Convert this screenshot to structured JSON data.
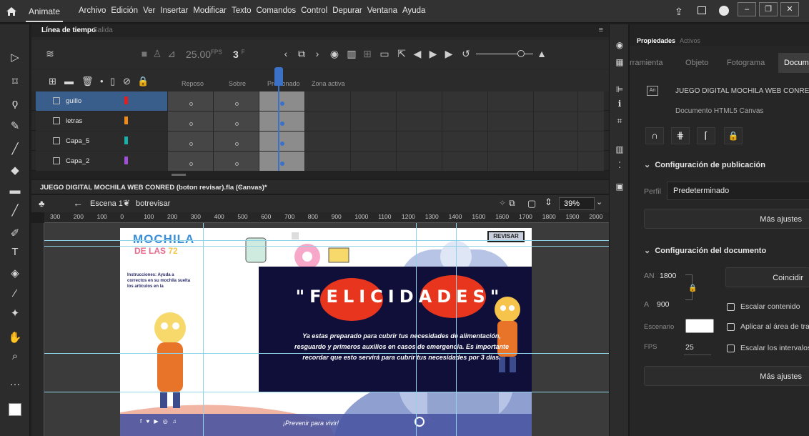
{
  "app": {
    "name": "Animate",
    "menus": [
      "Archivo",
      "Edición",
      "Ver",
      "Insertar",
      "Modificar",
      "Texto",
      "Comandos",
      "Control",
      "Depurar",
      "Ventana",
      "Ayuda"
    ]
  },
  "timeline": {
    "tabs": [
      "Línea de tiempo",
      "Salida"
    ],
    "fps": "25.00",
    "fps_unit": "FPS",
    "current_frame": "3",
    "frame_suffix": "F",
    "frame_labels": [
      "Reposo",
      "Sobre",
      "Presionado",
      "Zona activa"
    ],
    "layers": [
      {
        "name": "guillo",
        "color": "#e02020",
        "selected": true
      },
      {
        "name": "letras",
        "color": "#f08a1a",
        "selected": false
      },
      {
        "name": "Capa_5",
        "color": "#18b0a8",
        "selected": false
      },
      {
        "name": "Capa_2",
        "color": "#a050d8",
        "selected": false
      }
    ]
  },
  "document": {
    "tab": "JUEGO DIGITAL MOCHILA WEB CONRED (boton revisar).fla (Canvas)*",
    "scene": "Escena 1",
    "symbol": "botrevisar",
    "zoom": "39%",
    "ruler_marks": [
      "300",
      "200",
      "100",
      "0",
      "100",
      "200",
      "300",
      "400",
      "500",
      "600",
      "700",
      "800",
      "900",
      "1000",
      "1100",
      "1200",
      "1300",
      "1400",
      "1500",
      "1600",
      "1700",
      "1800",
      "1900",
      "2000"
    ]
  },
  "stage": {
    "title_line1": "MOCHILA",
    "title_line2": "DE LAS",
    "title_suffix": "72",
    "instructions": "Instrucciones: Ayuda a correctos en su mochila suelta los artículos en la",
    "revisar_button": "REVISAR",
    "modal_title": "\"FELICIDADES\"",
    "modal_text": "Ya estas preparado para cubrir tus necesidades de alimentación, resguardo y primeros auxilios en casos de emergencia. Es importante recordar que esto servirá para cubrir tus necesidades por 3 días.",
    "footer_slogan": "¡Prevenir para vivir!"
  },
  "properties": {
    "tabs": [
      "Propiedades",
      "Activos"
    ],
    "subtabs": [
      "rramienta",
      "Objeto",
      "Fotograma",
      "Documen"
    ],
    "doc_name": "JUEGO DIGITAL MOCHILA WEB CONRED",
    "doc_type": "Documento HTML5 Canvas",
    "publish_section": "Configuración de publicación",
    "profile_label": "Perfil",
    "profile_value": "Predeterminado",
    "more_settings": "Más ajustes",
    "doc_section": "Configuración del documento",
    "width_label": "AN",
    "width_value": "1800",
    "height_label": "A",
    "height_value": "900",
    "match_button": "Coincidir",
    "scale_content": "Escalar contenido",
    "stage_label": "Escenario",
    "apply_area": "Aplicar al área de tra",
    "fps_label": "FPS",
    "fps_value": "25",
    "scale_intervals": "Escalar los intervalos",
    "more_settings_2": "Más ajustes"
  }
}
